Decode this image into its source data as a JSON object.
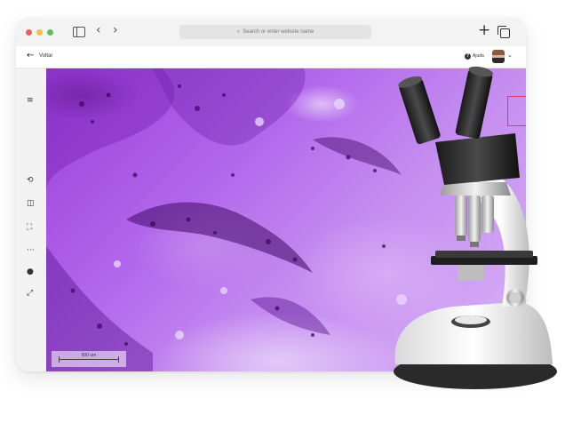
{
  "browser": {
    "url_placeholder": "Search or enter website name"
  },
  "header": {
    "back_label": "Voltar",
    "help_label": "Ajuda"
  },
  "viewer": {
    "scale_label": "500 um"
  },
  "icons": {
    "sidebar_toggle": "sidebar-icon",
    "back": "chevron-left-icon",
    "forward": "chevron-right-icon",
    "new_tab": "plus-icon",
    "tabs": "tabs-icon",
    "menu": "hamburger-menu-icon",
    "rail": [
      "rotate-icon",
      "compare-icon",
      "crop-icon",
      "more-icon",
      "circle-icon",
      "fullscreen-icon"
    ]
  },
  "colors": {
    "stain_primary": "#9a3fd8",
    "stain_dark": "#4a1070",
    "thumbnail_frame": "#e03a6a"
  }
}
